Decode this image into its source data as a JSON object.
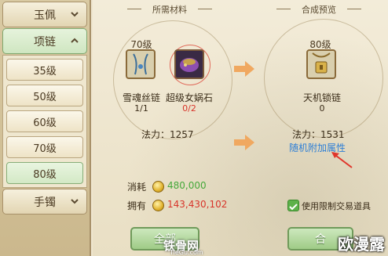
{
  "sidebar": {
    "categories": [
      {
        "label": "玉佩",
        "expanded": false
      },
      {
        "label": "项链",
        "expanded": true
      },
      {
        "label": "手镯",
        "expanded": false
      }
    ],
    "levels": [
      "35级",
      "50级",
      "60级",
      "70级",
      "80级"
    ],
    "selected_level": "80级"
  },
  "materials": {
    "title": "所需材料",
    "items": [
      {
        "level": "70级",
        "name": "雪魂丝链",
        "count": "1/1"
      },
      {
        "level": "",
        "name": "超级女娲石",
        "count": "0/2"
      }
    ],
    "power_label": "法力：1257"
  },
  "preview": {
    "title": "合成预览",
    "level": "80级",
    "name": "天机锁链",
    "count": "0",
    "power_label": "法力：1531",
    "random_attr_link": "随机附加属性"
  },
  "cost": {
    "consume_label": "消耗",
    "consume_value": "480,000",
    "own_label": "拥有",
    "own_value": "143,430,102",
    "restricted_label": "使用限制交易道具",
    "restricted_checked": true
  },
  "buttons": {
    "all_label": "全部",
    "synth_label": "合"
  },
  "watermarks": {
    "tiegu": "铁骨网",
    "tiegu_url": "TieGu.com",
    "brand": "欧漫露"
  },
  "colors": {
    "accent_green": "#45a83a",
    "insufficient_red": "#d8342a",
    "link_blue": "#2e7fd6"
  }
}
